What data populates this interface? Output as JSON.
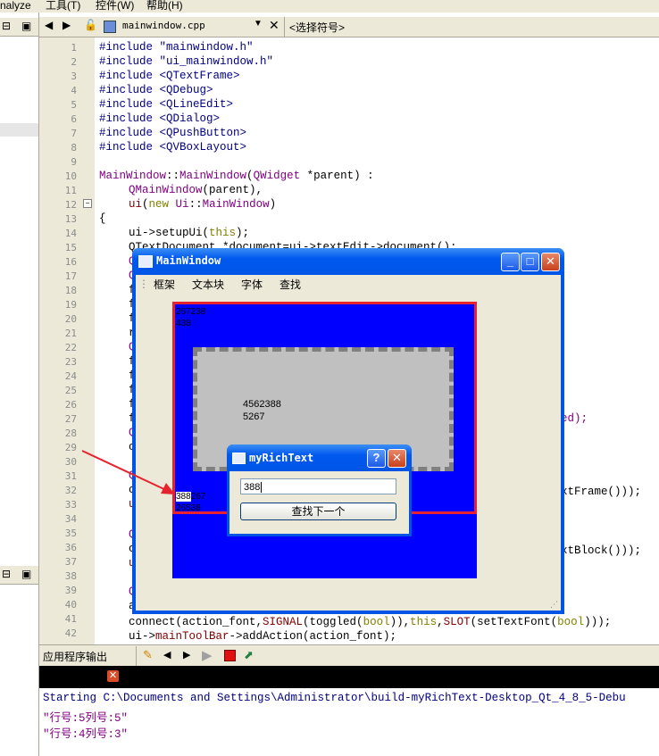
{
  "menubar": {
    "items": [
      "nalyze",
      "工具(T)",
      "控件(W)",
      "帮助(H)"
    ]
  },
  "editor_toolbar": {
    "filename": "mainwindow.cpp",
    "symbol": "<选择符号>"
  },
  "gutter": {
    "line_numbers": [
      "1",
      "2",
      "3",
      "4",
      "5",
      "6",
      "7",
      "8",
      "9",
      "10",
      "11",
      "12",
      "13",
      "14",
      "15",
      "16",
      "17",
      "18",
      "19",
      "20",
      "21",
      "22",
      "23",
      "24",
      "25",
      "26",
      "27",
      "28",
      "29",
      "30",
      "31",
      "32",
      "33",
      "34",
      "35",
      "36",
      "37",
      "38",
      "39",
      "40",
      "41",
      "42"
    ]
  },
  "code": {
    "l1": "#include \"mainwindow.h\"",
    "l2": "#include \"ui_mainwindow.h\"",
    "l3": "#include <QTextFrame>",
    "l4": "#include <QDebug>",
    "l5": "#include <QLineEdit>",
    "l6": "#include <QDialog>",
    "l7": "#include <QPushButton>",
    "l8": "#include <QVBoxLayout>",
    "l10a": "MainWindow",
    "l10b": "::",
    "l10c": "MainWindow",
    "l10d": "(",
    "l10e": "QWidget",
    "l10f": " *parent) :",
    "l11a": "QMainWindow",
    "l11b": "(parent),",
    "l12a": "ui",
    "l12b": "(",
    "l12c": "new",
    "l12d": " Ui",
    "l12e": "::",
    "l12f": "MainWindow",
    "l12g": ")",
    "l13": "{",
    "l14a": "ui->setupUi(",
    "l14b": "this",
    "l14c": ");",
    "l15": "QTextDocument *document=ui->textEdit->document();",
    "l27": "ed);",
    "l32": "xtFrame()));",
    "l36": "xtBlock()));",
    "l41a": "connect(action_font,",
    "l41b": "SIGNAL",
    "l41c": "(toggled(",
    "l41d": "bool",
    "l41e": ")),",
    "l41f": "this",
    "l41g": ",",
    "l41h": "SLOT",
    "l41i": "(setTextFont(",
    "l41j": "bool",
    "l41k": ")));",
    "l42a": "ui->",
    "l42b": "mainToolBar",
    "l42c": "->addAction(action_font);",
    "partial_leads": [
      "Q",
      "Q",
      "f",
      "f",
      "f",
      "r",
      "Q",
      "f",
      "f",
      "f",
      "f",
      "f",
      "Q",
      "c",
      "Q",
      "c",
      "u",
      "Q",
      "c",
      "u",
      "Q",
      "a"
    ]
  },
  "output": {
    "title": "应用程序输出",
    "lines": [
      "Starting C:\\Documents and Settings\\Administrator\\build-myRichText-Desktop_Qt_4_8_5-Debu",
      "\"行号:5列号:5\"",
      "\"行号:4列号:3\""
    ]
  },
  "mainwindow": {
    "title": "MainWindow",
    "menu": [
      "框架",
      "文本块",
      "字体",
      "查找"
    ],
    "text_top": [
      "267238",
      "438"
    ],
    "text_mid": [
      "4562388",
      "5267"
    ],
    "text_bottom": [
      "388",
      "267",
      "26538"
    ]
  },
  "richtext": {
    "title": "myRichText",
    "input_value": "388",
    "find_button": "查找下一个"
  },
  "colors": {
    "xp_blue": "#0054e3",
    "doc_blue": "#0000ff",
    "frame_red": "#e8222e",
    "arrow_red": "#e8222e"
  }
}
